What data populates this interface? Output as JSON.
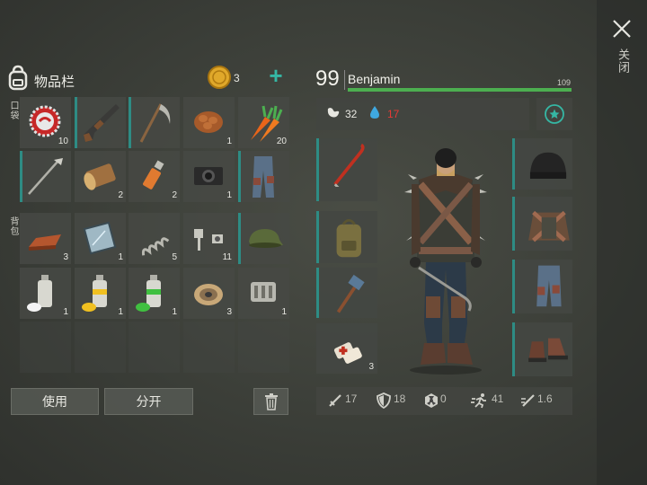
{
  "inventory": {
    "title": "物品栏",
    "pocket_label": "口袋",
    "backpack_label": "背包",
    "coins": "3",
    "add_symbol": "+",
    "slots": [
      {
        "icon": "bottle-cap-icon",
        "count": "10"
      },
      {
        "icon": "shotgun-icon",
        "count": ""
      },
      {
        "icon": "scythe-icon",
        "count": ""
      },
      {
        "icon": "pine-cone-icon",
        "count": "1"
      },
      {
        "icon": "carrot-icon",
        "count": "20"
      },
      {
        "icon": "golf-club-icon",
        "count": ""
      },
      {
        "icon": "log-icon",
        "count": "2"
      },
      {
        "icon": "flash-drive-icon",
        "count": "2"
      },
      {
        "icon": "camera-icon",
        "count": "1"
      },
      {
        "icon": "jeans-icon",
        "count": ""
      },
      {
        "icon": "copper-ingot-icon",
        "count": "3"
      },
      {
        "icon": "glass-pane-icon",
        "count": "1"
      },
      {
        "icon": "spring-icon",
        "count": "5"
      },
      {
        "icon": "bolts-icon",
        "count": "11"
      },
      {
        "icon": "military-cap-icon",
        "count": ""
      },
      {
        "icon": "spray-paint-white-icon",
        "count": "1"
      },
      {
        "icon": "spray-paint-yellow-icon",
        "count": "1"
      },
      {
        "icon": "spray-paint-green-icon",
        "count": "1"
      },
      {
        "icon": "wire-spool-icon",
        "count": "3"
      },
      {
        "icon": "engine-part-icon",
        "count": "1"
      }
    ],
    "use_label": "使用",
    "split_label": "分开"
  },
  "character": {
    "level": "99",
    "name": "Benjamin",
    "health_max": "109",
    "health_fraction": 1.0,
    "food": "32",
    "water": "17",
    "colors": {
      "health": "#4caf50",
      "water": "#e53935",
      "accent": "#2e8c84"
    }
  },
  "equipment": {
    "left": [
      {
        "icon": "crowbar-icon",
        "count": ""
      },
      {
        "icon": "backpack-icon",
        "count": ""
      },
      {
        "icon": "sledgehammer-icon",
        "count": ""
      },
      {
        "icon": "bandage-icon",
        "count": "3"
      }
    ],
    "right": [
      {
        "icon": "beanie-icon"
      },
      {
        "icon": "armored-jacket-icon"
      },
      {
        "icon": "armored-jeans-icon"
      },
      {
        "icon": "boots-icon"
      }
    ]
  },
  "stats": {
    "attack": "17",
    "defense": "18",
    "radiation": "0",
    "speed": "41",
    "attack_speed": "1.6"
  },
  "close_label": "关闭"
}
